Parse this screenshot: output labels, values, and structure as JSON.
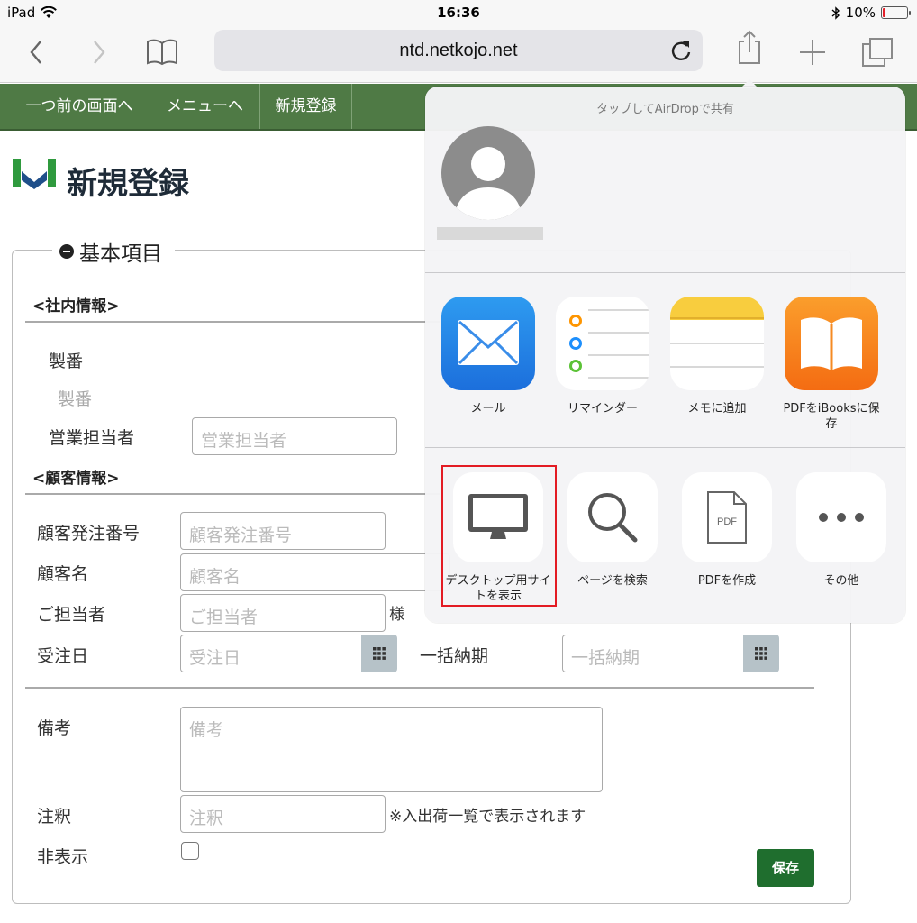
{
  "statusbar": {
    "device": "iPad",
    "time": "16:36",
    "battery": "10%",
    "battery_level": 0.1
  },
  "toolbar": {
    "url": "ntd.netkojo.net"
  },
  "nav": {
    "items": [
      "一つ前の画面へ",
      "メニューへ",
      "新規登録"
    ]
  },
  "page": {
    "title": "新規登録"
  },
  "form": {
    "legend": "基本項目",
    "section_internal": "<社内情報>",
    "section_customer": "<顧客情報>",
    "seiban_label": "製番",
    "seiban_value": "製番",
    "sales_label": "営業担当者",
    "sales_placeholder": "営業担当者",
    "order_no_label": "顧客発注番号",
    "order_no_placeholder": "顧客発注番号",
    "customer_label": "顧客名",
    "customer_placeholder": "顧客名",
    "contact_label": "ご担当者",
    "contact_placeholder": "ご担当者",
    "contact_suffix": "様",
    "order_date_label": "受注日",
    "order_date_placeholder": "受注日",
    "delivery_label": "一括納期",
    "delivery_placeholder": "一括納期",
    "remarks_label": "備考",
    "remarks_placeholder": "備考",
    "note_label": "注釈",
    "note_placeholder": "注釈",
    "note_hint": "※入出荷一覧で表示されます",
    "hidden_label": "非表示",
    "save_label": "保存"
  },
  "share": {
    "airdrop_hint": "タップしてAirDropで共有",
    "apps": [
      {
        "label": "メール",
        "icon": "mail-icon"
      },
      {
        "label": "リマインダー",
        "icon": "reminders-icon"
      },
      {
        "label": "メモに追加",
        "icon": "notes-icon"
      },
      {
        "label": "PDFをiBooksに保存",
        "icon": "ibooks-icon"
      }
    ],
    "actions": [
      {
        "label": "デスクトップ用サイトを表示",
        "icon": "desktop-icon"
      },
      {
        "label": "ページを検索",
        "icon": "search-icon"
      },
      {
        "label": "PDFを作成",
        "icon": "pdf-icon",
        "glyph": "PDF"
      },
      {
        "label": "その他",
        "icon": "more-icon"
      }
    ]
  }
}
